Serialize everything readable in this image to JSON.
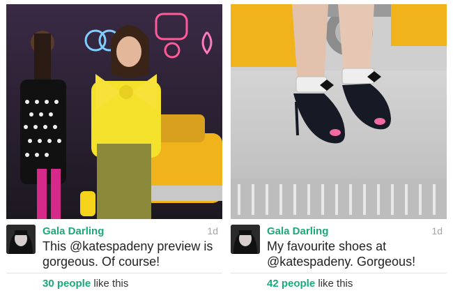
{
  "posts": [
    {
      "author": "Gala Darling",
      "age": "1d",
      "text": "This @katespadeny preview is gorgeous. Of course!",
      "likes_count": "30 people",
      "likes_suffix": " like this",
      "photo_icon": "runway-photo"
    },
    {
      "author": "Gala Darling",
      "age": "1d",
      "text": "My favourite shoes at @katespadeny. Gorgeous!",
      "likes_count": "42 people",
      "likes_suffix": " like this",
      "photo_icon": "shoes-photo"
    }
  ],
  "colors": {
    "accent": "#1aa97a",
    "text": "#222222",
    "muted": "#a3a3a3"
  }
}
